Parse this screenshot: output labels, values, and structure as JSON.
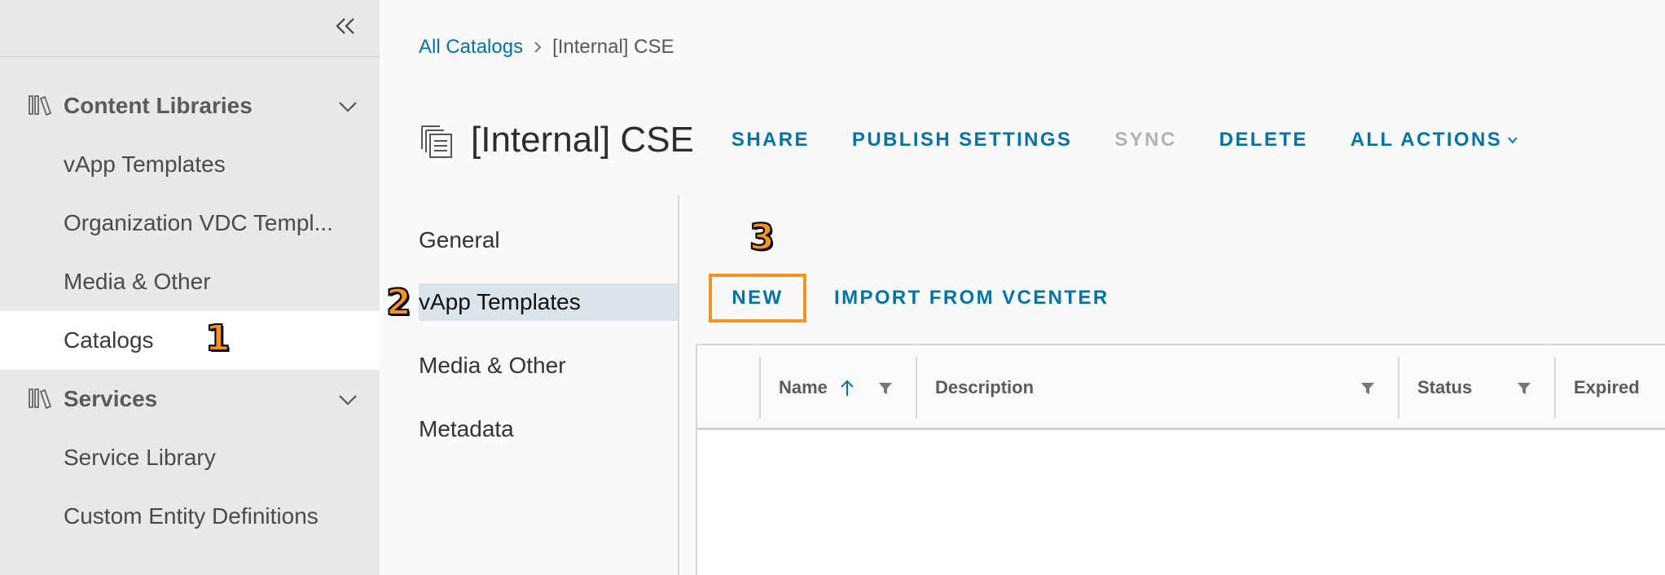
{
  "sidebar": {
    "groups": [
      {
        "label": "Content Libraries",
        "items": [
          "vApp Templates",
          "Organization VDC Templ...",
          "Media & Other",
          "Catalogs"
        ]
      },
      {
        "label": "Services",
        "items": [
          "Service Library",
          "Custom Entity Definitions"
        ]
      }
    ],
    "active_item": "Catalogs"
  },
  "markers": [
    "1",
    "2",
    "3"
  ],
  "breadcrumb": {
    "link": "All Catalogs",
    "current": "[Internal] CSE"
  },
  "header": {
    "title": "[Internal] CSE",
    "actions": {
      "share": "SHARE",
      "publish_settings": "PUBLISH SETTINGS",
      "sync": "SYNC",
      "delete": "DELETE",
      "all_actions": "ALL ACTIONS"
    }
  },
  "subnav": {
    "items": [
      "General",
      "vApp Templates",
      "Media & Other",
      "Metadata"
    ],
    "active_item": "vApp Templates"
  },
  "toolbar": {
    "new": "NEW",
    "import": "IMPORT FROM VCENTER"
  },
  "grid": {
    "columns": {
      "name": "Name",
      "description": "Description",
      "status": "Status",
      "expired": "Expired"
    }
  },
  "colors": {
    "link": "#0072a3",
    "highlight": "#f7931e",
    "sidebar_bg": "#e8e8e8",
    "active_subnav_bg": "#dae4ea"
  },
  "icons": [
    "collapse-double-chevron-left-icon",
    "library-icon",
    "chevron-down-icon",
    "chevron-right-icon",
    "catalog-copy-icon",
    "filter-icon",
    "sort-ascending-icon"
  ]
}
